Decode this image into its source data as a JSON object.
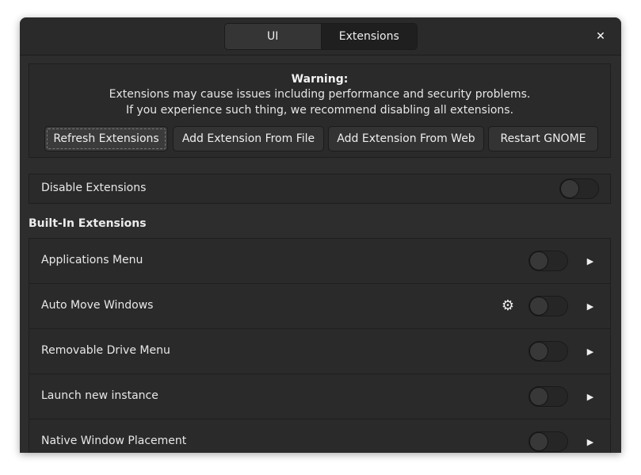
{
  "header": {
    "tabs": [
      {
        "label": "UI",
        "active": false
      },
      {
        "label": "Extensions",
        "active": true
      }
    ],
    "close_glyph": "✕"
  },
  "warning": {
    "title": "Warning:",
    "line1": "Extensions may cause issues including performance and security problems.",
    "line2": "If you experience such thing, we recommend disabling all extensions."
  },
  "buttons": {
    "refresh": "Refresh Extensions",
    "add_file": "Add Extension From File",
    "add_web": "Add Extension From Web",
    "restart": "Restart GNOME"
  },
  "disable_row": {
    "label": "Disable Extensions",
    "enabled": false
  },
  "section_title": "Built-In Extensions",
  "extensions": [
    {
      "label": "Applications Menu",
      "enabled": false,
      "has_settings": false
    },
    {
      "label": "Auto Move Windows",
      "enabled": false,
      "has_settings": true
    },
    {
      "label": "Removable Drive Menu",
      "enabled": false,
      "has_settings": false
    },
    {
      "label": "Launch new instance",
      "enabled": false,
      "has_settings": false
    },
    {
      "label": "Native Window Placement",
      "enabled": false,
      "has_settings": false
    }
  ],
  "icons": {
    "gear": "gear-icon",
    "arrow": "chevron-right-icon",
    "close": "close-icon"
  },
  "colors": {
    "window_bg": "#2d2d2d",
    "panel_bg": "#2a2a2a",
    "text": "#e8e8e8"
  }
}
